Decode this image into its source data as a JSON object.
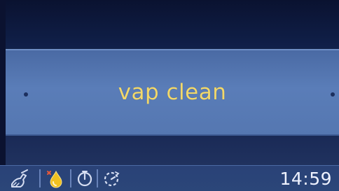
{
  "display": {
    "message": "vap clean"
  },
  "status_bar": {
    "time": "14:59",
    "icons": [
      {
        "name": "cleaning-brush-icon"
      },
      {
        "name": "steam-drop-icon"
      },
      {
        "name": "timer-icon"
      },
      {
        "name": "delayed-start-icon"
      }
    ]
  },
  "colors": {
    "message_text": "#f2d86a",
    "band": "#5577b1",
    "background": "#0c1430",
    "status_bar": "#2b4679",
    "drop_icon": "#f0c020"
  }
}
